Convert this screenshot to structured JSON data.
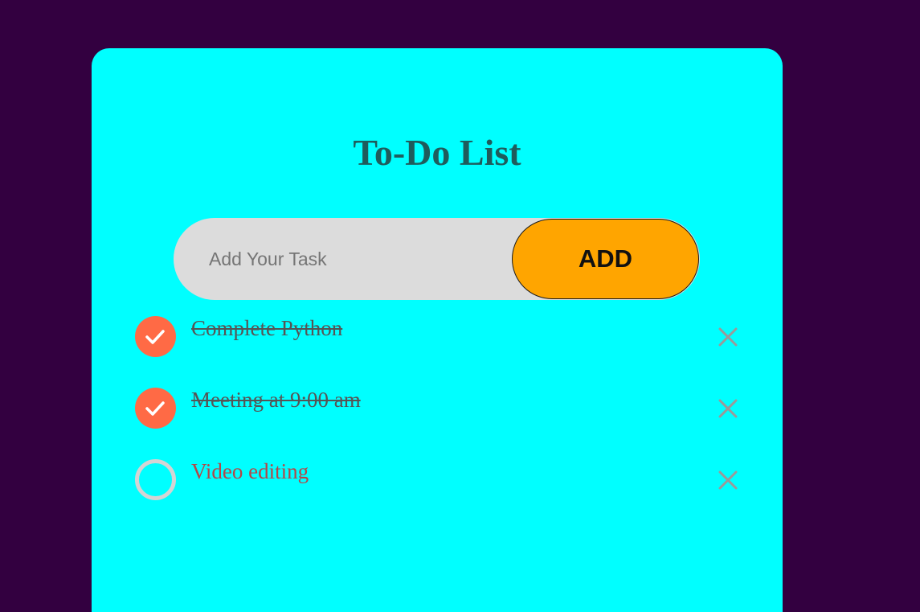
{
  "app": {
    "title": "To-Do List"
  },
  "input": {
    "placeholder": "Add Your Task",
    "value": ""
  },
  "add_button": {
    "label": "ADD"
  },
  "tasks": [
    {
      "text": "Complete Python",
      "completed": true
    },
    {
      "text": "Meeting at 9:00 am",
      "completed": true
    },
    {
      "text": "Video editing",
      "completed": false
    }
  ],
  "icons": {
    "checked": "checkmark-icon",
    "unchecked": "empty-circle-icon",
    "delete": "close-icon"
  },
  "colors": {
    "page_background": "#330040",
    "card_background": "#00ffff",
    "title": "#1f5c5c",
    "input_background": "#dcdcdc",
    "add_button": "#ffa500",
    "check_done": "#ff6a45",
    "task_open_text": "#b34747",
    "task_done_text": "#555555",
    "delete_icon": "#9a9a9a"
  }
}
